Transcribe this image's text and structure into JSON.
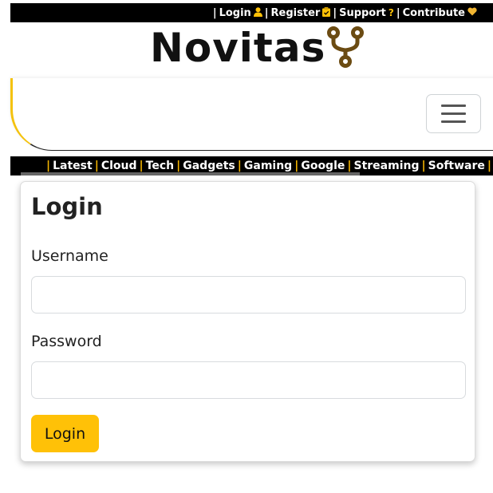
{
  "topbar": {
    "login": "Login",
    "register": "Register",
    "support": "Support",
    "contribute": "Contribute",
    "separator": "|",
    "support_icon": "?"
  },
  "brand": {
    "name": "Novitas",
    "logo_icon": "fork-branch-icon",
    "logo_color": "#6b4b12"
  },
  "navbar": {
    "toggler_icon": "hamburger-menu-icon"
  },
  "categories": {
    "items": [
      "Latest",
      "Cloud",
      "Tech",
      "Gadgets",
      "Gaming",
      "Google",
      "Streaming",
      "Software"
    ],
    "separator": "|",
    "accent": "#f4b400"
  },
  "login_form": {
    "title": "Login",
    "username_label": "Username",
    "username_value": "",
    "password_label": "Password",
    "password_value": "",
    "submit_label": "Login",
    "button_color": "#ffc107"
  }
}
